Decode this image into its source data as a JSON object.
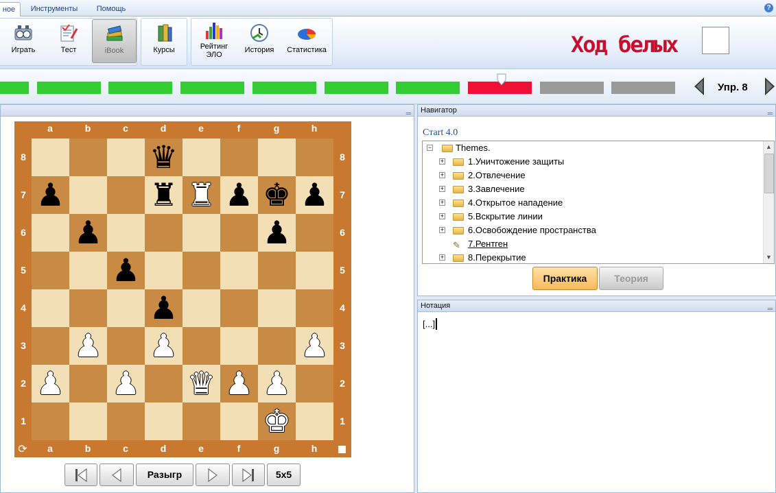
{
  "menu": {
    "tabs": [
      {
        "label": "ное"
      },
      {
        "label": "Инструменты"
      },
      {
        "label": "Помощь"
      }
    ],
    "help_icon": "?"
  },
  "ribbon": {
    "buttons": [
      {
        "label": "Играть",
        "icon": "chess-clock-icon"
      },
      {
        "label": "Тест",
        "icon": "test-icon"
      },
      {
        "label": "iBook",
        "icon": "book-stack-icon",
        "selected": true
      },
      {
        "label": "Курсы",
        "icon": "books-icon"
      },
      {
        "label": "Рейтинг\nЭЛО",
        "icon": "bar-chart-icon"
      },
      {
        "label": "История",
        "icon": "history-clock-icon"
      },
      {
        "label": "Статистика",
        "icon": "pie-chart-icon"
      }
    ],
    "turn_label": "Ход белых",
    "turn_color": "#ffffff"
  },
  "progress": {
    "segments": [
      "done",
      "done",
      "done",
      "done",
      "done",
      "done",
      "done",
      "failed",
      "pending",
      "pending"
    ],
    "colors": {
      "done": "#33cc33",
      "failed": "#ee1133",
      "pending": "#9a9a9a"
    },
    "current_index": 7,
    "label": "Упр. 8"
  },
  "board": {
    "files": [
      "a",
      "b",
      "c",
      "d",
      "e",
      "f",
      "g",
      "h"
    ],
    "ranks": [
      "8",
      "7",
      "6",
      "5",
      "4",
      "3",
      "2",
      "1"
    ],
    "position": [
      [
        "",
        "",
        "",
        "bq",
        "",
        "",
        "",
        ""
      ],
      [
        "bp",
        "",
        "",
        "br",
        "wr",
        "bp",
        "bk",
        "bp"
      ],
      [
        "",
        "bp",
        "",
        "",
        "",
        "",
        "bp",
        ""
      ],
      [
        "",
        "",
        "bp",
        "",
        "",
        "",
        "",
        ""
      ],
      [
        "",
        "",
        "",
        "bp",
        "",
        "",
        "",
        ""
      ],
      [
        "",
        "wp",
        "",
        "wp",
        "",
        "",
        "",
        "wp"
      ],
      [
        "wp",
        "",
        "wp",
        "",
        "wq",
        "wp",
        "wp",
        ""
      ],
      [
        "",
        "",
        "",
        "",
        "",
        "",
        "wk",
        ""
      ]
    ],
    "controls": {
      "first": "⏮",
      "prev": "◀",
      "analyze": "Разыгр",
      "next": "▶",
      "last": "⏭",
      "size": "5x5"
    }
  },
  "navigator": {
    "header": "Навигатор",
    "course_title": "Cтart 4.0",
    "tree": {
      "root": "Themes.",
      "items": [
        {
          "label": "1.Уничтожение защиты",
          "type": "folder"
        },
        {
          "label": "2.Отвлечение",
          "type": "folder"
        },
        {
          "label": "3.Завлечение",
          "type": "folder"
        },
        {
          "label": "4.Открытое нападение",
          "type": "folder"
        },
        {
          "label": "5.Вскрытие линии",
          "type": "folder"
        },
        {
          "label": "6.Освобождение пространства",
          "type": "folder"
        },
        {
          "label": "7.Рентген",
          "type": "document",
          "active": true
        },
        {
          "label": "8.Перекрытие",
          "type": "folder"
        }
      ]
    },
    "tab_practice": "Практика",
    "tab_theory": "Теория"
  },
  "notation": {
    "header": "Нотация",
    "text": "[...]"
  }
}
